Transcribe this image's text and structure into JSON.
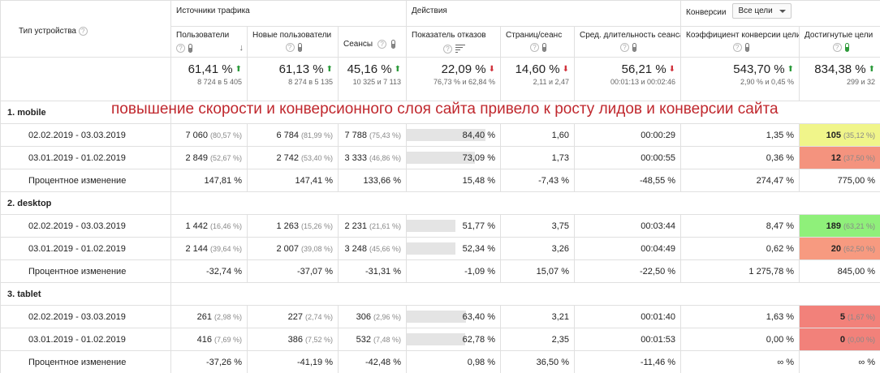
{
  "header": {
    "device_type": "Тип устройства",
    "group_traffic": "Источники трафика",
    "group_actions": "Действия",
    "group_conversions": "Конверсии",
    "goal_select": "Все цели",
    "columns": [
      "Пользователи",
      "Новые пользователи",
      "Сеансы",
      "Показатель отказов",
      "Страниц/сеанс",
      "Сред. длительность сеанса",
      "Коэффициент конверсии цели",
      "Достигнутые цели"
    ]
  },
  "totals": [
    {
      "main": "61,41 %",
      "dir": "up",
      "sub": "8 724 в 5 405"
    },
    {
      "main": "61,13 %",
      "dir": "up",
      "sub": "8 274 в 5 135"
    },
    {
      "main": "45,16 %",
      "dir": "up",
      "sub": "10 325 и 7 113"
    },
    {
      "main": "22,09 %",
      "dir": "down",
      "sub": "76,73 % и 62,84 %"
    },
    {
      "main": "14,60 %",
      "dir": "down",
      "sub": "2,11 и 2,47"
    },
    {
      "main": "56,21 %",
      "dir": "down",
      "sub": "00:01:13 и 00:02:46"
    },
    {
      "main": "543,70 %",
      "dir": "up",
      "sub": "2,90 % и 0,45 %"
    },
    {
      "main": "834,38 %",
      "dir": "up",
      "sub": "299 и 32"
    }
  ],
  "annotation": "повышение скорости и конверсионного слоя сайта привело к росту лидов и конверсии сайта",
  "segments": [
    {
      "name": "1.   mobile",
      "rows": [
        {
          "label": "02.02.2019 - 03.03.2019",
          "users": "7 060",
          "users_pct": "(80,57 %)",
          "new": "6 784",
          "new_pct": "(81,99 %)",
          "sessions": "7 788",
          "sessions_pct": "(75,43 %)",
          "bounce": "84,40 %",
          "bounce_fill": 84.4,
          "pages": "1,60",
          "duration": "00:00:29",
          "conv": "1,35 %",
          "goals": "105",
          "goals_pct": "(35,12 %)",
          "goals_color": "#f0f58a"
        },
        {
          "label": "03.01.2019 - 01.02.2019",
          "users": "2 849",
          "users_pct": "(52,67 %)",
          "new": "2 742",
          "new_pct": "(53,40 %)",
          "sessions": "3 333",
          "sessions_pct": "(46,86 %)",
          "bounce": "73,09 %",
          "bounce_fill": 73.09,
          "pages": "1,73",
          "duration": "00:00:55",
          "conv": "0,36 %",
          "goals": "12",
          "goals_pct": "(37,50 %)",
          "goals_color": "#f4937e"
        },
        {
          "label": "Процентное изменение",
          "users": "147,81 %",
          "new": "147,41 %",
          "sessions": "133,66 %",
          "bounce": "15,48 %",
          "pages": "-7,43 %",
          "duration": "-48,55 %",
          "conv": "274,47 %",
          "goals": "775,00 %"
        }
      ]
    },
    {
      "name": "2.   desktop",
      "rows": [
        {
          "label": "02.02.2019 - 03.03.2019",
          "users": "1 442",
          "users_pct": "(16,46 %)",
          "new": "1 263",
          "new_pct": "(15,26 %)",
          "sessions": "2 231",
          "sessions_pct": "(21,61 %)",
          "bounce": "51,77 %",
          "bounce_fill": 51.77,
          "pages": "3,75",
          "duration": "00:03:44",
          "conv": "8,47 %",
          "goals": "189",
          "goals_pct": "(63,21 %)",
          "goals_color": "#8ff07a"
        },
        {
          "label": "03.01.2019 - 01.02.2019",
          "users": "2 144",
          "users_pct": "(39,64 %)",
          "new": "2 007",
          "new_pct": "(39,08 %)",
          "sessions": "3 248",
          "sessions_pct": "(45,66 %)",
          "bounce": "52,34 %",
          "bounce_fill": 52.34,
          "pages": "3,26",
          "duration": "00:04:49",
          "conv": "0,62 %",
          "goals": "20",
          "goals_pct": "(62,50 %)",
          "goals_color": "#f79a80"
        },
        {
          "label": "Процентное изменение",
          "users": "-32,74 %",
          "new": "-37,07 %",
          "sessions": "-31,31 %",
          "bounce": "-1,09 %",
          "pages": "15,07 %",
          "duration": "-22,50 %",
          "conv": "1 275,78 %",
          "goals": "845,00 %"
        }
      ]
    },
    {
      "name": "3.   tablet",
      "rows": [
        {
          "label": "02.02.2019 - 03.03.2019",
          "users": "261",
          "users_pct": "(2,98 %)",
          "new": "227",
          "new_pct": "(2,74 %)",
          "sessions": "306",
          "sessions_pct": "(2,96 %)",
          "bounce": "63,40 %",
          "bounce_fill": 63.4,
          "pages": "3,21",
          "duration": "00:01:40",
          "conv": "1,63 %",
          "goals": "5",
          "goals_pct": "(1,67 %)",
          "goals_color": "#f2817a"
        },
        {
          "label": "03.01.2019 - 01.02.2019",
          "users": "416",
          "users_pct": "(7,69 %)",
          "new": "386",
          "new_pct": "(7,52 %)",
          "sessions": "532",
          "sessions_pct": "(7,48 %)",
          "bounce": "62,78 %",
          "bounce_fill": 62.78,
          "pages": "2,35",
          "duration": "00:01:53",
          "conv": "0,00 %",
          "goals": "0",
          "goals_pct": "(0,00 %)",
          "goals_color": "#f2817a"
        },
        {
          "label": "Процентное изменение",
          "users": "-37,26 %",
          "new": "-41,19 %",
          "sessions": "-42,48 %",
          "bounce": "0,98 %",
          "pages": "36,50 %",
          "duration": "-11,46 %",
          "conv": "∞ %",
          "goals": "∞ %"
        }
      ]
    }
  ]
}
